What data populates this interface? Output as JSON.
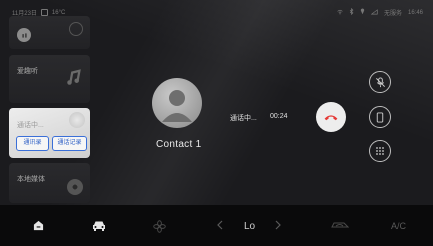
{
  "status_bar": {
    "date": "11月23日",
    "temp": "16°C",
    "network_label": "无服务",
    "time": "16:46"
  },
  "cards": [
    {
      "label": ""
    },
    {
      "label": "爱趣听"
    },
    {
      "label": "通话中..."
    },
    {
      "label": "本地媒体"
    }
  ],
  "call_card_buttons": {
    "contacts": "通讯录",
    "call_log": "通话记录"
  },
  "call": {
    "contact_name": "Contact 1",
    "status": "通话中...",
    "timer": "00:24"
  },
  "bottom_bar": {
    "temp_setting": "Lo",
    "ac_label": "A/C"
  }
}
